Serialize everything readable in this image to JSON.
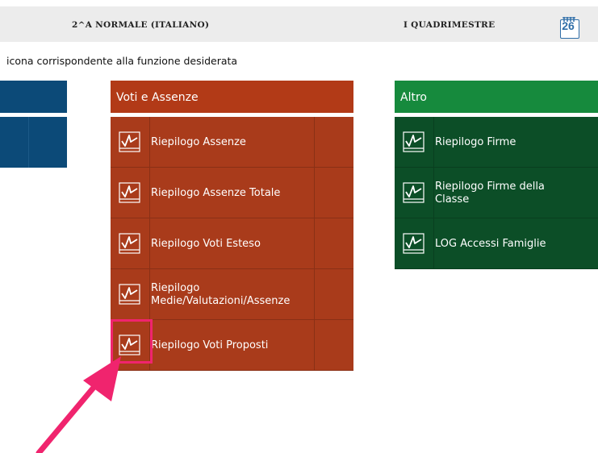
{
  "header": {
    "class_name": "2^A NORMALE (ITALIANO)",
    "period": "I QUADRIMESTRE",
    "calendar_day": "26"
  },
  "subtitle": "icona corrispondente alla funzione desiderata",
  "voti_panel": {
    "title": "Voti e Assenze",
    "items": [
      {
        "label": "Riepilogo Assenze"
      },
      {
        "label": "Riepilogo Assenze Totale"
      },
      {
        "label": "Riepilogo Voti Esteso"
      },
      {
        "label": "Riepilogo\nMedie/Valutazioni/Assenze"
      },
      {
        "label": "Riepilogo Voti Proposti"
      }
    ],
    "color": "#a93b1b",
    "header_color": "#b23a17"
  },
  "altro_panel": {
    "title": "Altro",
    "items": [
      {
        "label": "Riepilogo Firme"
      },
      {
        "label": "Riepilogo Firme della\nClasse"
      },
      {
        "label": "LOG Accessi Famiglie"
      }
    ],
    "color": "#0c4e27",
    "header_color": "#168a3d"
  },
  "annotation": {
    "color": "#f0246e",
    "icon": "chart-icon"
  }
}
